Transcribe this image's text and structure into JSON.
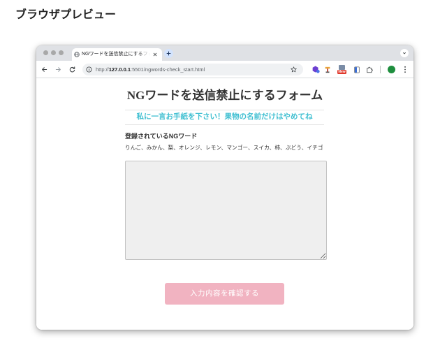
{
  "page": {
    "heading": "ブラウザプレビュー"
  },
  "browser": {
    "window_controls": [
      "window-close-dot",
      "window-minimize-dot",
      "window-maximize-dot"
    ],
    "tab": {
      "favicon": "globe-icon",
      "title": "NGワードを送信禁止にするフォ",
      "close_icon": "close-icon"
    },
    "new_tab_icon": "plus-icon",
    "tab_search_icon": "chevron-down-icon",
    "nav": {
      "back_icon": "arrow-left-icon",
      "forward_icon": "arrow-right-icon",
      "reload_icon": "reload-icon"
    },
    "address": {
      "site_info_icon": "info-icon",
      "url_scheme": "http://",
      "url_host": "127.0.0.1",
      "url_rest": ":5501/ngwords-check_start.html",
      "bookmark_icon": "star-icon"
    },
    "toolbar_icons": [
      "extension-shield-icon",
      "extension-tool-icon",
      "extension-new-icon",
      "extension-doc-icon",
      "puzzle-icon",
      "profile-avatar",
      "kebab-menu-icon"
    ],
    "extension_new_badge": "New"
  },
  "form": {
    "title": "NGワードを送信禁止にするフォーム",
    "subtitle": "私に一言お手紙を下さい！果物の名前だけはやめてね",
    "ng_label": "登録されているNGワード",
    "ng_words": "りんご、みかん、梨、オレンジ、レモン、マンゴー、スイカ、柿、ぶどう、イチゴ",
    "textarea_value": "",
    "submit_label": "入力内容を確認する"
  },
  "colors": {
    "accent_teal": "#42c0d2",
    "button_pink": "#f1b3c1",
    "tabstrip_gray": "#dfe1e5",
    "omnibox_gray": "#eff1f3",
    "textarea_bg": "#efefef",
    "avatar_green": "#1e8e3e"
  }
}
